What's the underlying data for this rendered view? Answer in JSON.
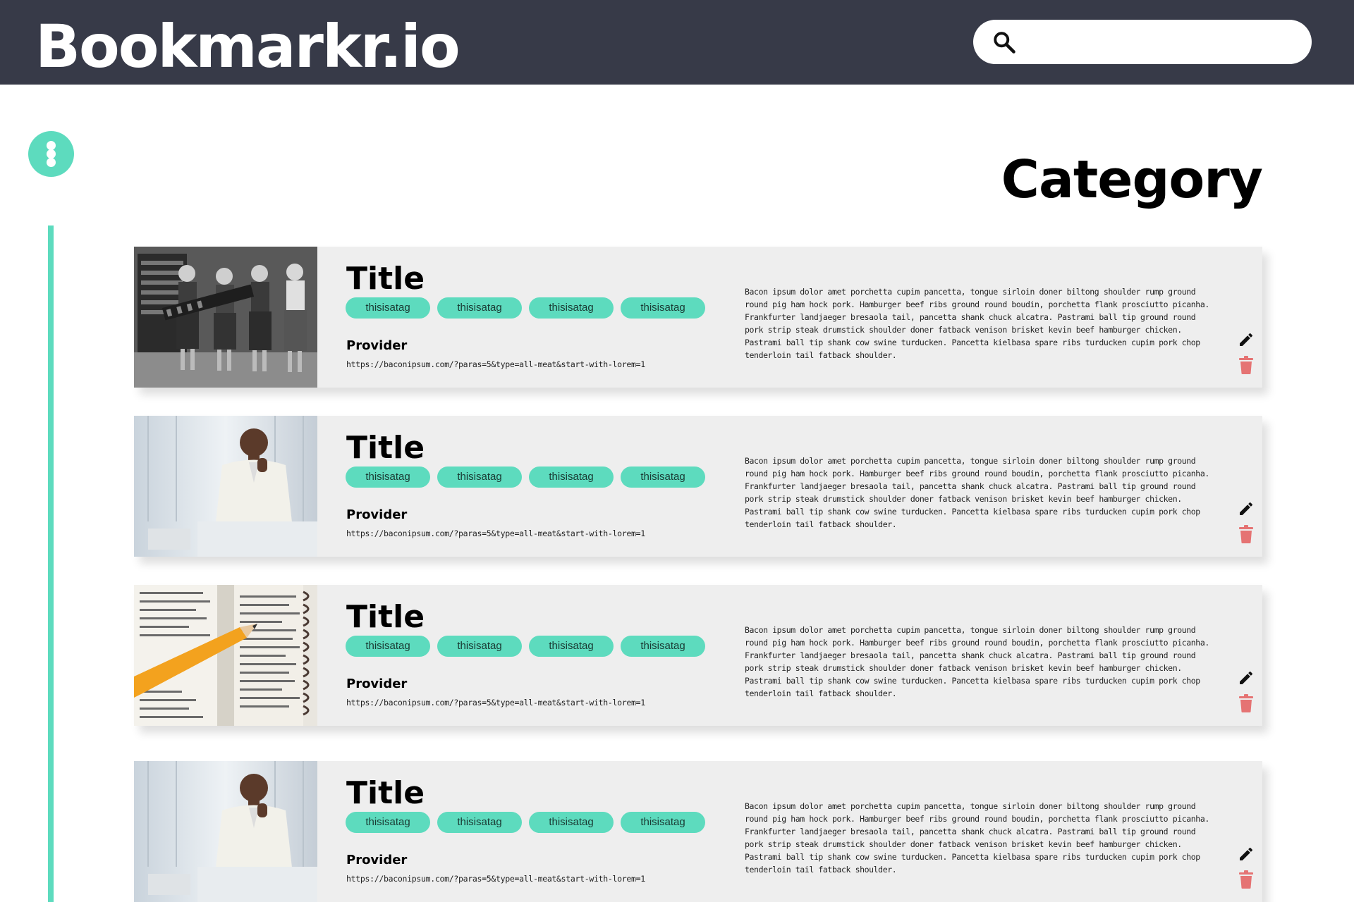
{
  "app": {
    "title": "Bookmarkr.io"
  },
  "search": {
    "placeholder": "",
    "value": ""
  },
  "page": {
    "title": "Category"
  },
  "colors": {
    "header": "#373a48",
    "accent": "#5ddbbe",
    "card": "#eeeeee",
    "delete": "#e57373"
  },
  "bookmarks": [
    {
      "title": "Title",
      "tags": [
        "thisisatag",
        "thisisatag",
        "thisisatag",
        "thisisatag"
      ],
      "provider": "Provider",
      "url": "https://baconipsum.com/?paras=5&type=all-meat&start-with-lorem=1",
      "description": "Bacon ipsum dolor amet porchetta cupim pancetta, tongue sirloin doner biltong shoulder rump ground round pig ham hock pork. Hamburger beef ribs ground round boudin, porchetta flank prosciutto picanha. Frankfurter landjaeger bresaola tail, pancetta shank chuck alcatra. Pastrami ball tip ground round pork strip steak drumstick shoulder doner fatback venison brisket kevin beef hamburger chicken. Pastrami ball tip shank cow swine turducken. Pancetta kielbasa spare ribs turducken cupim pork chop tenderloin tail fatback shoulder.",
      "thumbnail": "vintage-photo-women-computer"
    },
    {
      "title": "Title",
      "tags": [
        "thisisatag",
        "thisisatag",
        "thisisatag",
        "thisisatag"
      ],
      "provider": "Provider",
      "url": "https://baconipsum.com/?paras=5&type=all-meat&start-with-lorem=1",
      "description": "Bacon ipsum dolor amet porchetta cupim pancetta, tongue sirloin doner biltong shoulder rump ground round pig ham hock pork. Hamburger beef ribs ground round boudin, porchetta flank prosciutto picanha. Frankfurter landjaeger bresaola tail, pancetta shank chuck alcatra. Pastrami ball tip ground round pork strip steak drumstick shoulder doner fatback venison brisket kevin beef hamburger chicken. Pastrami ball tip shank cow swine turducken. Pancetta kielbasa spare ribs turducken cupim pork chop tenderloin tail fatback shoulder.",
      "thumbnail": "man-in-white-suit"
    },
    {
      "title": "Title",
      "tags": [
        "thisisatag",
        "thisisatag",
        "thisisatag",
        "thisisatag"
      ],
      "provider": "Provider",
      "url": "https://baconipsum.com/?paras=5&type=all-meat&start-with-lorem=1",
      "description": "Bacon ipsum dolor amet porchetta cupim pancetta, tongue sirloin doner biltong shoulder rump ground round pig ham hock pork. Hamburger beef ribs ground round boudin, porchetta flank prosciutto picanha. Frankfurter landjaeger bresaola tail, pancetta shank chuck alcatra. Pastrami ball tip ground round pork strip steak drumstick shoulder doner fatback venison brisket kevin beef hamburger chicken. Pastrami ball tip shank cow swine turducken. Pancetta kielbasa spare ribs turducken cupim pork chop tenderloin tail fatback shoulder.",
      "thumbnail": "dictionary-with-pencil"
    },
    {
      "title": "Title",
      "tags": [
        "thisisatag",
        "thisisatag",
        "thisisatag",
        "thisisatag"
      ],
      "provider": "Provider",
      "url": "https://baconipsum.com/?paras=5&type=all-meat&start-with-lorem=1",
      "description": "Bacon ipsum dolor amet porchetta cupim pancetta, tongue sirloin doner biltong shoulder rump ground round pig ham hock pork. Hamburger beef ribs ground round boudin, porchetta flank prosciutto picanha. Frankfurter landjaeger bresaola tail, pancetta shank chuck alcatra. Pastrami ball tip ground round pork strip steak drumstick shoulder doner fatback venison brisket kevin beef hamburger chicken. Pastrami ball tip shank cow swine turducken. Pancetta kielbasa spare ribs turducken cupim pork chop tenderloin tail fatback shoulder.",
      "thumbnail": "man-in-white-suit"
    }
  ]
}
